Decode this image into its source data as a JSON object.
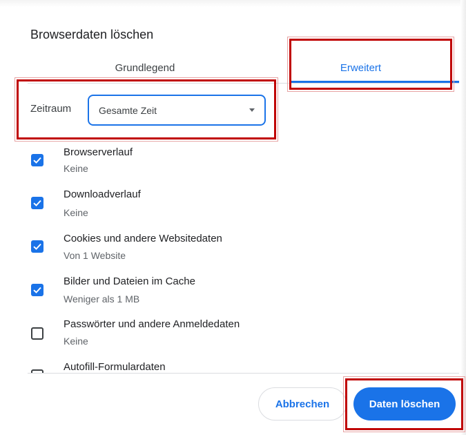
{
  "dialog": {
    "title": "Browserdaten löschen"
  },
  "tabs": [
    {
      "label": "Grundlegend",
      "selected": false
    },
    {
      "label": "Erweitert",
      "selected": true
    }
  ],
  "time_range": {
    "label": "Zeitraum",
    "value": "Gesamte Zeit"
  },
  "options": [
    {
      "label": "Browserverlauf",
      "detail": "Keine",
      "checked": true
    },
    {
      "label": "Downloadverlauf",
      "detail": "Keine",
      "checked": true
    },
    {
      "label": "Cookies und andere Websitedaten",
      "detail": "Von 1 Website",
      "checked": true
    },
    {
      "label": "Bilder und Dateien im Cache",
      "detail": "Weniger als 1 MB",
      "checked": true
    },
    {
      "label": "Passwörter und andere Anmeldedaten",
      "detail": "Keine",
      "checked": false
    },
    {
      "label": "Autofill-Formulardaten",
      "detail": "",
      "checked": false
    }
  ],
  "buttons": {
    "cancel": "Abbrechen",
    "delete": "Daten löschen"
  },
  "colors": {
    "accent": "#1a73e8",
    "highlight": "#c00000"
  }
}
